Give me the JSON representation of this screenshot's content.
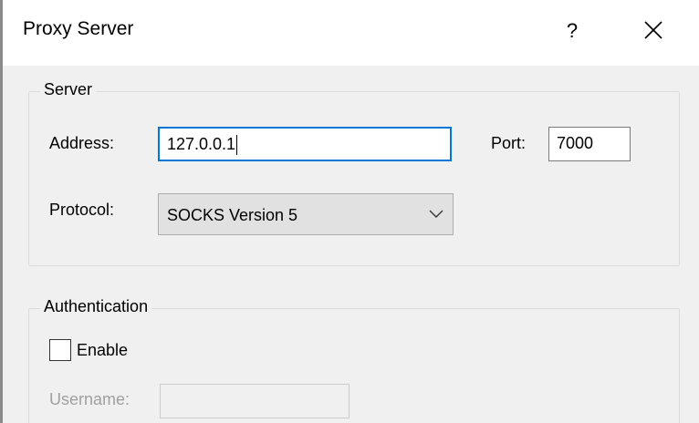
{
  "window": {
    "title": "Proxy Server",
    "help_glyph": "?"
  },
  "server": {
    "group_label": "Server",
    "address_label": "Address:",
    "address_value": "127.0.0.1",
    "port_label": "Port:",
    "port_value": "7000",
    "protocol_label": "Protocol:",
    "protocol_selected": "SOCKS Version 5"
  },
  "authentication": {
    "group_label": "Authentication",
    "enable_label": "Enable",
    "enable_checked": false,
    "username_label": "Username:",
    "username_value": ""
  },
  "icons": {
    "help": "question-mark-icon",
    "close": "close-icon",
    "dropdown": "chevron-down-icon"
  },
  "colors": {
    "focus_border": "#0078d7",
    "disabled_text": "#a0a0a0",
    "dialog_background": "#f0f0f0"
  }
}
